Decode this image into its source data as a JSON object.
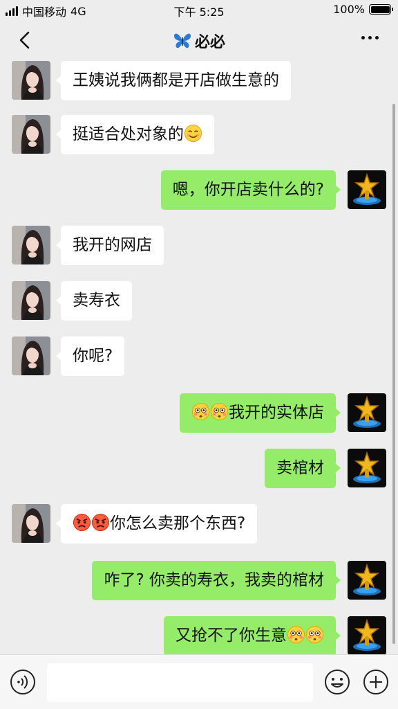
{
  "status_bar": {
    "carrier": "中国移动",
    "network": "4G",
    "time": "下午 5:25",
    "battery_percent": "100%"
  },
  "header": {
    "title": "必必",
    "title_icon": "butterfly-emoji"
  },
  "messages": [
    {
      "side": "left",
      "text": "王姨说我俩都是开店做生意的",
      "emoji_before": [],
      "emoji_after": []
    },
    {
      "side": "left",
      "text": "挺适合处对象的",
      "emoji_before": [],
      "emoji_after": [
        "smile"
      ]
    },
    {
      "side": "right",
      "text": "嗯，你开店卖什么的?",
      "emoji_before": [],
      "emoji_after": []
    },
    {
      "side": "left",
      "text": "我开的网店",
      "emoji_before": [],
      "emoji_after": []
    },
    {
      "side": "left",
      "text": "卖寿衣",
      "emoji_before": [],
      "emoji_after": []
    },
    {
      "side": "left",
      "text": "你呢?",
      "emoji_before": [],
      "emoji_after": []
    },
    {
      "side": "right",
      "text": "我开的实体店",
      "emoji_before": [
        "flushed",
        "flushed"
      ],
      "emoji_after": []
    },
    {
      "side": "right",
      "text": "卖棺材",
      "emoji_before": [],
      "emoji_after": []
    },
    {
      "side": "left",
      "text": "你怎么卖那个东西?",
      "emoji_before": [
        "angry",
        "angry"
      ],
      "emoji_after": []
    },
    {
      "side": "right",
      "text": "咋了? 你卖的寿衣，我卖的棺材",
      "emoji_before": [],
      "emoji_after": []
    },
    {
      "side": "right",
      "text": "又抢不了你生意",
      "emoji_before": [],
      "emoji_after": [
        "flushed",
        "flushed"
      ]
    }
  ],
  "input": {
    "value": "",
    "voice_icon": "voice-icon",
    "emoji_icon": "emoji-icon",
    "plus_icon": "plus-icon"
  },
  "colors": {
    "sent_bubble": "#95ec69",
    "received_bubble": "#ffffff",
    "background": "#ededed"
  }
}
